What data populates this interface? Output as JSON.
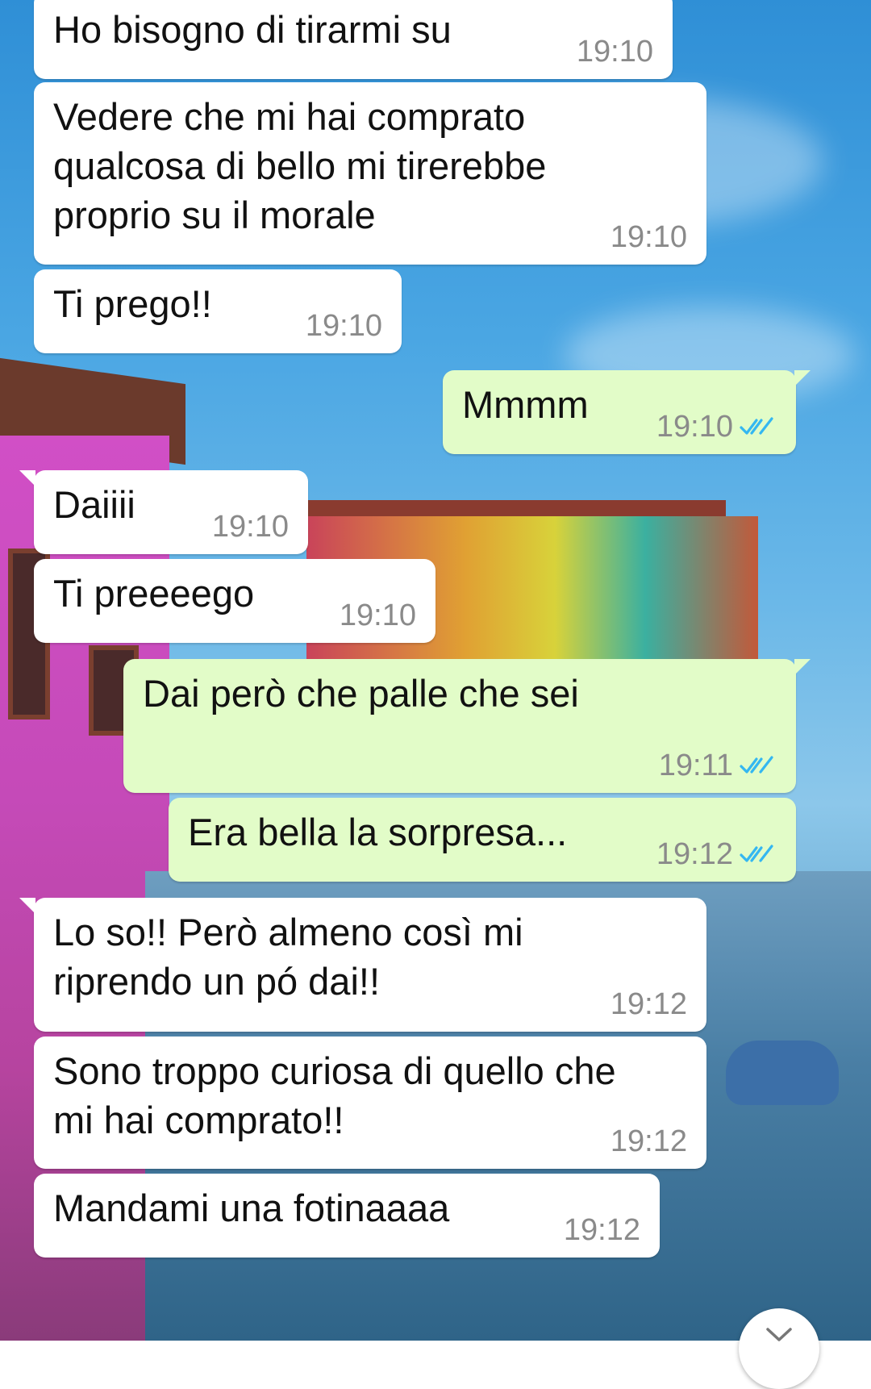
{
  "messages": [
    {
      "id": "m1",
      "direction": "in",
      "text": "Ho bisogno di tirarmi su",
      "time": "19:10"
    },
    {
      "id": "m2",
      "direction": "in",
      "text": "Vedere che mi hai comprato\nqualcosa di bello mi tirerebbe\nproprio su il morale",
      "time": "19:10"
    },
    {
      "id": "m3",
      "direction": "in",
      "text": "Ti prego!!",
      "time": "19:10"
    },
    {
      "id": "m4",
      "direction": "out",
      "text": "Mmmm",
      "time": "19:10",
      "status": "read"
    },
    {
      "id": "m5",
      "direction": "in",
      "text": "Daiiii",
      "time": "19:10"
    },
    {
      "id": "m6",
      "direction": "in",
      "text": "Ti preeeego",
      "time": "19:10"
    },
    {
      "id": "m7",
      "direction": "out",
      "text": "Dai però che palle che sei",
      "time": "19:11",
      "status": "read"
    },
    {
      "id": "m8",
      "direction": "out",
      "text": "Era bella la sorpresa...",
      "time": "19:12",
      "status": "read"
    },
    {
      "id": "m9",
      "direction": "in",
      "text": "Lo so!! Però almeno così mi\nriprendo un pó dai!!",
      "time": "19:12"
    },
    {
      "id": "m10",
      "direction": "in",
      "text": "Sono troppo curiosa di quello che\nmi hai comprato!!",
      "time": "19:12"
    },
    {
      "id": "m11",
      "direction": "in",
      "text": "Mandami una fotinaaaa",
      "time": "19:12"
    }
  ],
  "colors": {
    "incoming_bubble": "#ffffff",
    "outgoing_bubble": "#e2fcc8",
    "read_ticks": "#34b7f1",
    "timestamp": "#8a8a8a"
  },
  "icons": {
    "read_receipt": "double-check-icon",
    "scroll_down": "chevron-down-icon"
  }
}
